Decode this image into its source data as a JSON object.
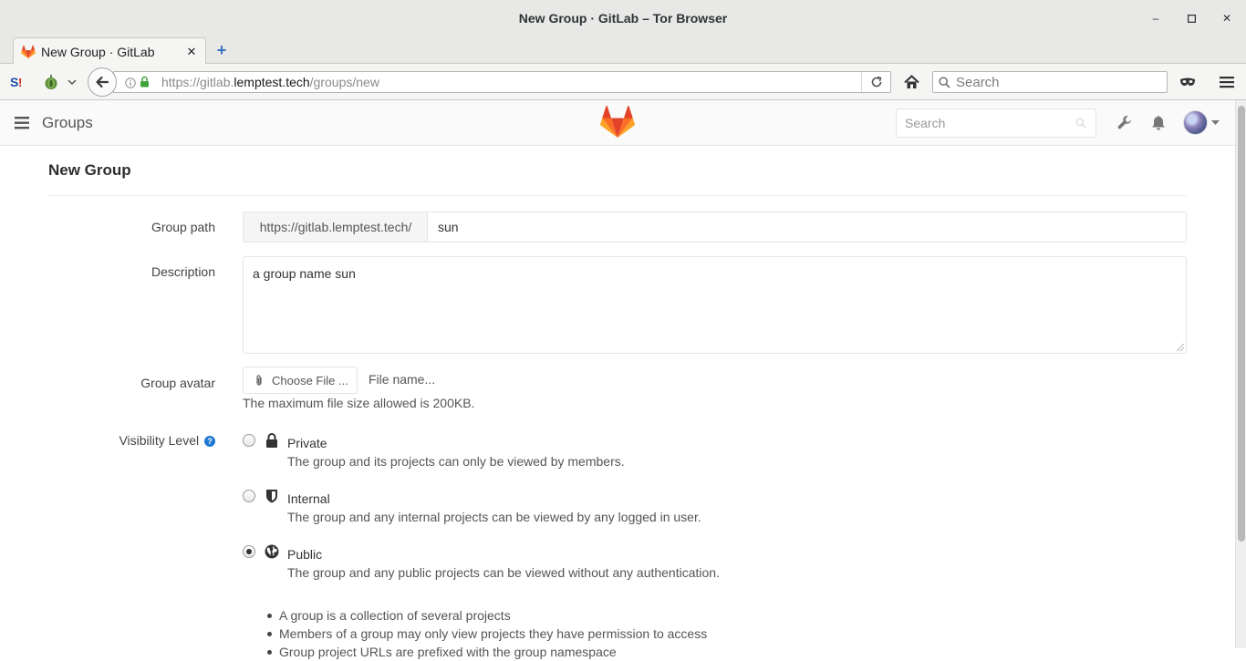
{
  "window": {
    "title": "New Group · GitLab – Tor Browser",
    "minimize": "‒",
    "maximize": "▫",
    "close": "✕"
  },
  "tabs": [
    {
      "label": "New Group · GitLab",
      "close": "✕"
    }
  ],
  "new_tab": "+",
  "address": {
    "url_prefix": "https://gitlab.",
    "url_domain": "lemptest.tech",
    "url_path": "/groups/new"
  },
  "browser_search": {
    "placeholder": "Search"
  },
  "gitlab_header": {
    "section_title": "Groups",
    "search_placeholder": "Search"
  },
  "page": {
    "title": "New Group"
  },
  "form": {
    "group_path_label": "Group path",
    "group_path_prefix": "https://gitlab.lemptest.tech/",
    "group_path_value": "sun",
    "description_label": "Description",
    "description_value": "a group name sun",
    "avatar_label": "Group avatar",
    "choose_file_label": "Choose File ...",
    "file_name_placeholder": "File name...",
    "file_size_help": "The maximum file size allowed is 200KB.",
    "visibility_label": "Visibility Level",
    "visibility_help_icon": "?",
    "visibility_options": [
      {
        "name": "Private",
        "description": "The group and its projects can only be viewed by members.",
        "icon": "lock-icon",
        "checked": false
      },
      {
        "name": "Internal",
        "description": "The group and any internal projects can be viewed by any logged in user.",
        "icon": "shield-icon",
        "checked": false
      },
      {
        "name": "Public",
        "description": "The group and any public projects can be viewed without any authentication.",
        "icon": "globe-icon",
        "checked": true
      }
    ],
    "info_bullets": [
      "A group is a collection of several projects",
      "Members of a group may only view projects they have permission to access",
      "Group project URLs are prefixed with the group namespace"
    ]
  },
  "colors": {
    "gitlab_orange": "#e24329",
    "gitlab_orange_light": "#fc6d26",
    "gitlab_orange_mid": "#fca326",
    "tor_purple": "#7d4698",
    "link_blue": "#1f78d1"
  }
}
